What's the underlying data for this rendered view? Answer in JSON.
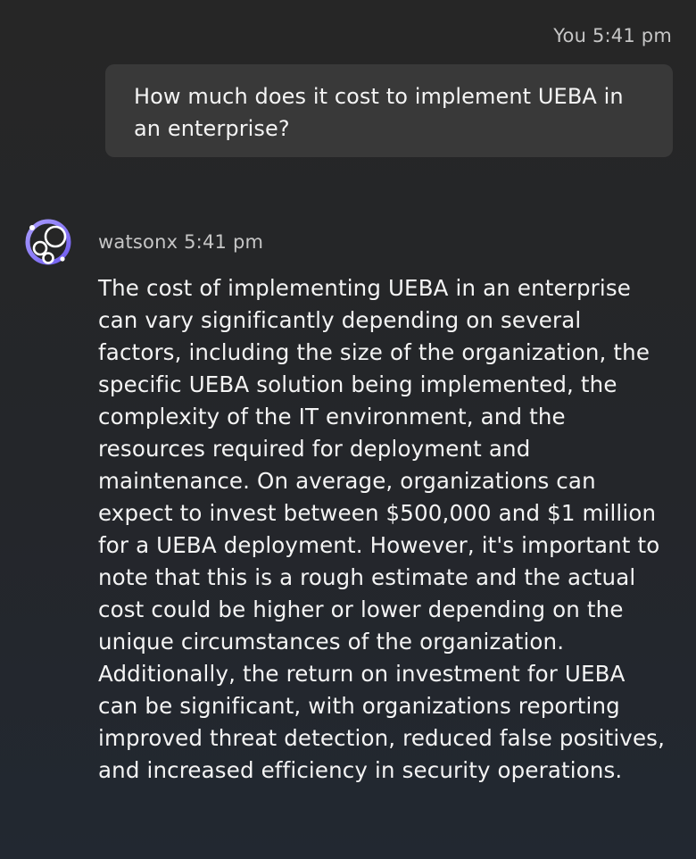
{
  "user_message": {
    "author": "You",
    "time": "5:41 pm",
    "text": "How much does it cost to implement UEBA in an enterprise?"
  },
  "bot_message": {
    "author": "watsonx",
    "time": "5:41 pm",
    "avatar_icon": "watsonx-logo-icon",
    "text": "The cost of implementing UEBA in an enterprise can vary significantly depending on several factors, including the size of the organization, the specific UEBA solution being implemented, the complexity of the IT environment, and the resources required for deployment and maintenance. On average, organizations can expect to invest between $500,000 and $1 million for a UEBA deployment. However, it's important to note that this is a rough estimate and the actual cost could be higher or lower depending on the unique circumstances of the organization. Additionally, the return on investment for UEBA can be significant, with organizations reporting improved threat detection, reduced false positives, and increased efficiency in security operations."
  },
  "colors": {
    "background": "#262626",
    "bubble": "#393939",
    "text": "#f4f4f4",
    "meta": "#c6c6c6",
    "avatar_accent": "#8a7cff"
  }
}
